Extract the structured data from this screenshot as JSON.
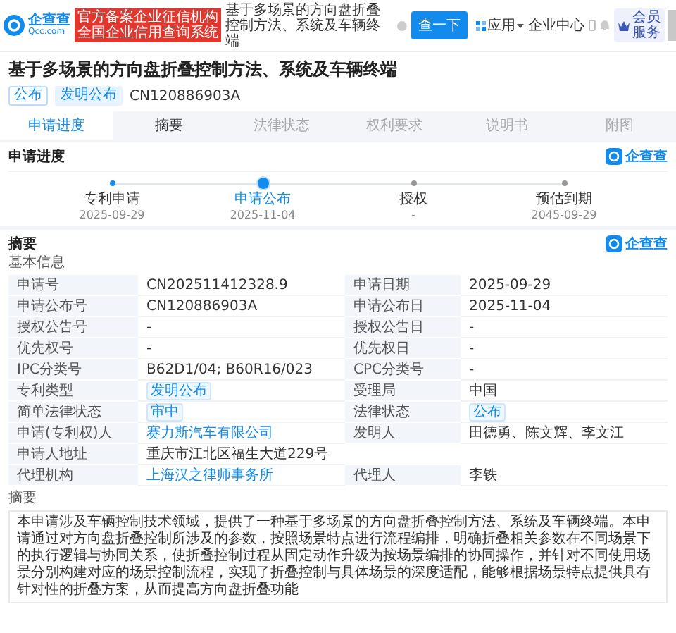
{
  "header": {
    "logo": {
      "name": "企查查",
      "domain": "Qcc.com"
    },
    "badge_lines": [
      "官方备案企业征信机构",
      "全国企业信用查询系统"
    ],
    "search": {
      "value": "基于多场景的方向盘折叠控制方法、系统及车辆终端"
    },
    "search_button": "查一下",
    "apps_menu": "应用",
    "enterprise_center": "企业中心",
    "member_lines": [
      "会员",
      "服务"
    ]
  },
  "title": "基于多场景的方向盘折叠控制方法、系统及车辆终端",
  "tags": [
    {
      "label": "公布",
      "kind": "outline"
    },
    {
      "label": "发明公布",
      "kind": "filled"
    }
  ],
  "publication_number": "CN120886903A",
  "tabs": [
    {
      "label": "申请进度",
      "selected": true,
      "disabled": false
    },
    {
      "label": "摘要",
      "selected": false,
      "disabled": false
    },
    {
      "label": "法律状态",
      "selected": false,
      "disabled": true
    },
    {
      "label": "权利要求",
      "selected": false,
      "disabled": true
    },
    {
      "label": "说明书",
      "selected": false,
      "disabled": true
    },
    {
      "label": "附图",
      "selected": false,
      "disabled": true
    }
  ],
  "progress": {
    "heading": "申请进度",
    "brand": "企查查",
    "steps": [
      {
        "label": "专利申请",
        "date": "2025-09-29",
        "kind": "done"
      },
      {
        "label": "申请公布",
        "date": "2025-11-04",
        "kind": "current"
      },
      {
        "label": "授权",
        "date": "-",
        "kind": "pending"
      },
      {
        "label": "预估到期",
        "date": "2045-09-29",
        "kind": "pending"
      }
    ]
  },
  "abstract_section": {
    "heading": "摘要",
    "brand": "企查查",
    "subheading": "基本信息",
    "rows": [
      [
        {
          "label": "申请号",
          "value": "CN202511412328.9",
          "kind": "text"
        },
        {
          "label": "申请日期",
          "value": "2025-09-29",
          "kind": "text"
        }
      ],
      [
        {
          "label": "申请公布号",
          "value": "CN120886903A",
          "kind": "text"
        },
        {
          "label": "申请公布日",
          "value": "2025-11-04",
          "kind": "text"
        }
      ],
      [
        {
          "label": "授权公告号",
          "value": "-",
          "kind": "text"
        },
        {
          "label": "授权公告日",
          "value": "-",
          "kind": "text"
        }
      ],
      [
        {
          "label": "优先权号",
          "value": "-",
          "kind": "text"
        },
        {
          "label": "优先权日",
          "value": "-",
          "kind": "text"
        }
      ],
      [
        {
          "label": "IPC分类号",
          "value": "B62D1/04; B60R16/023",
          "kind": "text"
        },
        {
          "label": "CPC分类号",
          "value": "-",
          "kind": "text"
        }
      ],
      [
        {
          "label": "专利类型",
          "value": "发明公布",
          "kind": "tag"
        },
        {
          "label": "受理局",
          "value": "中国",
          "kind": "text"
        }
      ],
      [
        {
          "label": "简单法律状态",
          "value": "审中",
          "kind": "tag"
        },
        {
          "label": "法律状态",
          "value": "公布",
          "kind": "tag"
        }
      ],
      [
        {
          "label": "申请(专利权)人",
          "value": "赛力斯汽车有限公司",
          "kind": "link"
        },
        {
          "label": "发明人",
          "value": "田德勇、陈文辉、李文江",
          "kind": "text"
        }
      ],
      [
        {
          "label": "申请人地址",
          "value": "重庆市江北区福生大道229号",
          "kind": "text"
        }
      ],
      [
        {
          "label": "代理机构",
          "value": "上海汉之律师事务所",
          "kind": "link"
        },
        {
          "label": "代理人",
          "value": "李铁",
          "kind": "text"
        }
      ]
    ]
  },
  "summary": {
    "heading": "摘要",
    "text": "本申请涉及车辆控制技术领域，提供了一种基于多场景的方向盘折叠控制方法、系统及车辆终端。本申请通过对方向盘折叠控制所涉及的参数，按照场景特点进行流程编排，明确折叠相关参数在不同场景下的执行逻辑与协同关系，使折叠控制过程从固定动作升级为按场景编排的协同操作，并针对不同使用场景分别构建对应的场景控制流程，实现了折叠控制与具体场景的深度适配，能够根据场景特点提供具有针对性的折叠方案，从而提高方向盘折叠功能"
  }
}
